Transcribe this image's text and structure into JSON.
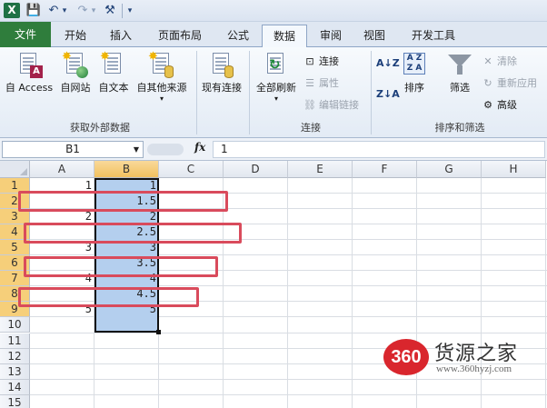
{
  "quick_access": {
    "logo": "X",
    "save_icon": "💾",
    "undo_icon": "↶",
    "redo_icon": "↷",
    "customize_icon": "⚒",
    "more_icon": "▾"
  },
  "tabs": [
    {
      "label": "文件",
      "name": "tab-file"
    },
    {
      "label": "开始",
      "name": "tab-home"
    },
    {
      "label": "插入",
      "name": "tab-insert"
    },
    {
      "label": "页面布局",
      "name": "tab-page-layout"
    },
    {
      "label": "公式",
      "name": "tab-formulas"
    },
    {
      "label": "数据",
      "name": "tab-data"
    },
    {
      "label": "审阅",
      "name": "tab-review"
    },
    {
      "label": "视图",
      "name": "tab-view"
    },
    {
      "label": "开发工具",
      "name": "tab-developer"
    }
  ],
  "ribbon": {
    "external": {
      "access": "自 Access",
      "web": "自网站",
      "text": "自文本",
      "other": "自其他来源",
      "group_label": "获取外部数据"
    },
    "existing": "现有连接",
    "connections": {
      "refresh_all": "全部刷新",
      "connect": "连接",
      "properties": "属性",
      "edit_links": "编辑链接",
      "group_label": "连接"
    },
    "sort_filter": {
      "sort": "排序",
      "filter": "筛选",
      "clear": "清除",
      "reapply": "重新应用",
      "advanced": "高级",
      "group_label": "排序和筛选"
    }
  },
  "formula_bar": {
    "name_box": "B1",
    "fx": "fx",
    "formula": "1"
  },
  "grid": {
    "columns": [
      "A",
      "B",
      "C",
      "D",
      "E",
      "F",
      "G",
      "H"
    ],
    "rows": [
      "1",
      "2",
      "3",
      "4",
      "5",
      "6",
      "7",
      "8",
      "9",
      "10",
      "11",
      "12",
      "13",
      "14",
      "15"
    ],
    "a_values": [
      "1",
      "",
      "2",
      "",
      "3",
      "",
      "4",
      "",
      "5"
    ],
    "b_values": [
      "1",
      "1.5",
      "2",
      "2.5",
      "3",
      "3.5",
      "4",
      "4.5",
      "5"
    ]
  },
  "watermark": {
    "badge": "360",
    "title": "货源之家",
    "url": "www.360hyzj.com"
  }
}
